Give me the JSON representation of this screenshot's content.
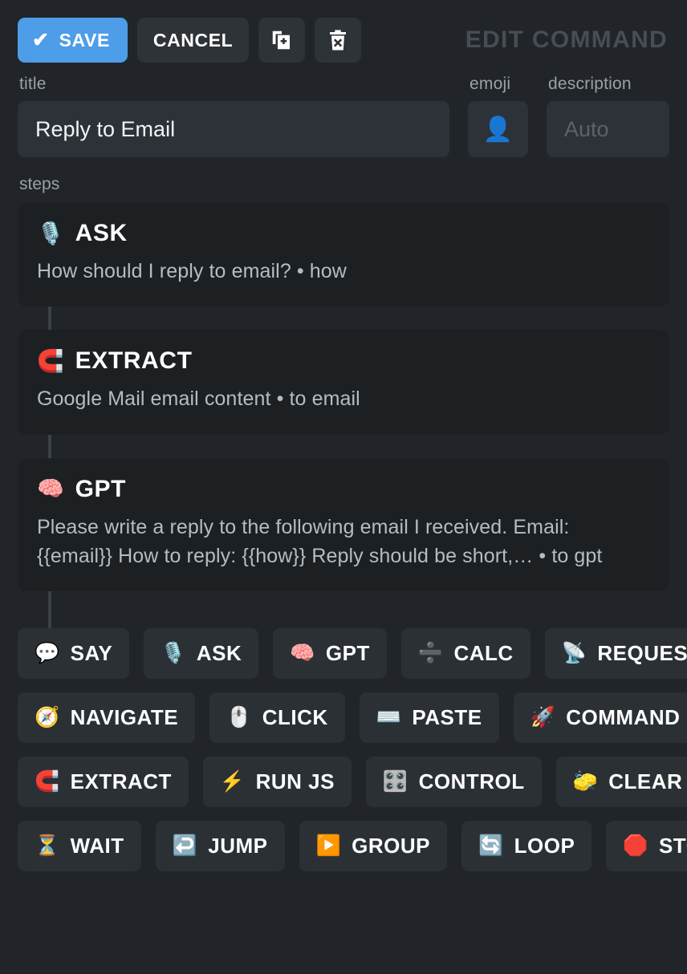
{
  "header": {
    "title": "EDIT COMMAND",
    "save_label": "SAVE",
    "save_icon": "check-icon",
    "cancel_label": "CANCEL",
    "duplicate_icon": "duplicate-icon",
    "delete_icon": "trash-delete-icon",
    "accent_color": "#4d9de8",
    "title_color": "#474d54"
  },
  "fields": {
    "title": {
      "label": "title",
      "value": "Reply to Email"
    },
    "emoji": {
      "label": "emoji",
      "value": "👤",
      "icon_name": "bust-in-silhouette-icon"
    },
    "description": {
      "label": "description",
      "value": "",
      "placeholder": "Auto"
    }
  },
  "steps_section": {
    "label": "steps",
    "steps": [
      {
        "emoji": "🎙️",
        "icon_name": "microphone-icon",
        "name": "ASK",
        "description": "How should I reply to email? • how"
      },
      {
        "emoji": "🧲",
        "icon_name": "magnet-icon",
        "name": "EXTRACT",
        "description": "Google Mail email content • to email"
      },
      {
        "emoji": "🧠",
        "icon_name": "brain-icon",
        "name": "GPT",
        "description": "Please write a reply to the following email I received. Email: {{email}} How to reply: {{how}} Reply should be short,… • to gpt"
      }
    ]
  },
  "palette": {
    "rows": [
      [
        {
          "emoji": "💬",
          "icon_name": "speech-balloon-icon",
          "label": "SAY"
        },
        {
          "emoji": "🎙️",
          "icon_name": "microphone-icon",
          "label": "ASK"
        },
        {
          "emoji": "🧠",
          "icon_name": "brain-icon",
          "label": "GPT"
        },
        {
          "emoji": "➗",
          "icon_name": "divide-icon",
          "label": "CALC"
        },
        {
          "emoji": "📡",
          "icon_name": "satellite-antenna-icon",
          "label": "REQUEST"
        }
      ],
      [
        {
          "emoji": "🧭",
          "icon_name": "compass-icon",
          "label": "NAVIGATE"
        },
        {
          "emoji": "🖱️",
          "icon_name": "computer-mouse-icon",
          "label": "CLICK"
        },
        {
          "emoji": "⌨️",
          "icon_name": "keyboard-icon",
          "label": "PASTE"
        },
        {
          "emoji": "🚀",
          "icon_name": "rocket-icon",
          "label": "COMMAND"
        }
      ],
      [
        {
          "emoji": "🧲",
          "icon_name": "magnet-icon",
          "label": "EXTRACT"
        },
        {
          "emoji": "⚡",
          "icon_name": "lightning-bolt-icon",
          "label": "RUN JS"
        },
        {
          "emoji": "🎛️",
          "icon_name": "control-knobs-icon",
          "label": "CONTROL"
        },
        {
          "emoji": "🧽",
          "icon_name": "sponge-icon",
          "label": "CLEAR"
        }
      ],
      [
        {
          "emoji": "⏳",
          "icon_name": "hourglass-icon",
          "label": "WAIT"
        },
        {
          "emoji": "↩️",
          "icon_name": "arrow-hook-left-icon",
          "label": "JUMP"
        },
        {
          "emoji": "▶️",
          "icon_name": "play-button-icon",
          "label": "GROUP"
        },
        {
          "emoji": "🔄",
          "icon_name": "loop-arrows-icon",
          "label": "LOOP"
        },
        {
          "emoji": "🛑",
          "icon_name": "stop-sign-icon",
          "label": "STOP"
        }
      ]
    ]
  }
}
